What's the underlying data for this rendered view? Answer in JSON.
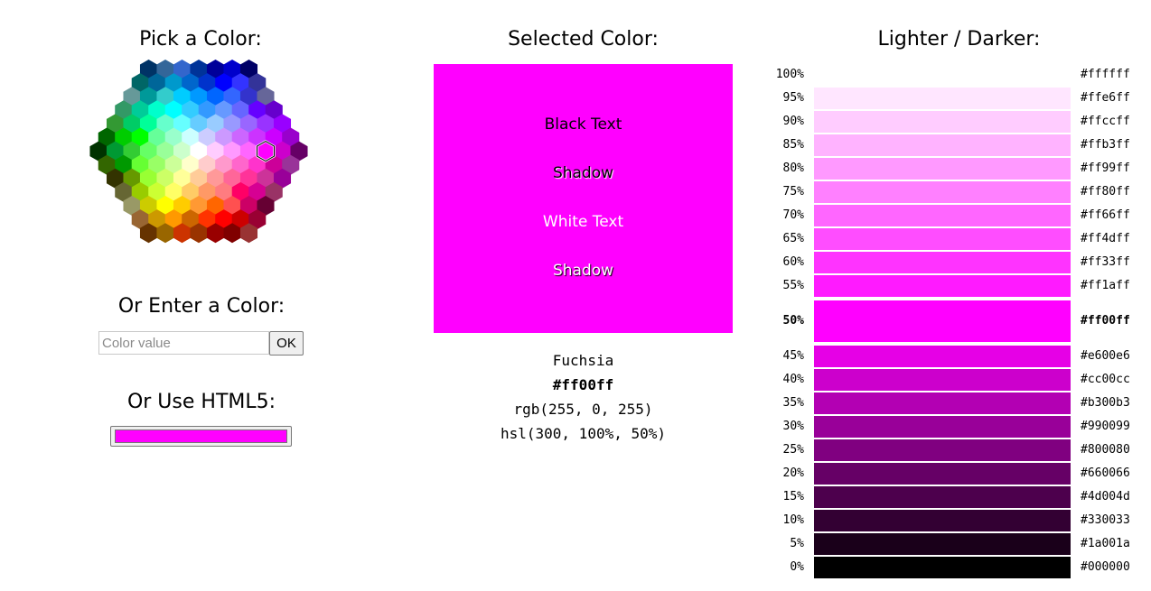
{
  "picker": {
    "title": "Pick a Color:",
    "selected_hex": "#ff00ff",
    "hex_rows": [
      [
        "#003366",
        "#336699",
        "#3366cc",
        "#003399",
        "#000099",
        "#0000cc",
        "#000066"
      ],
      [
        "#006666",
        "#006699",
        "#0099cc",
        "#0066cc",
        "#0033cc",
        "#0000ff",
        "#3333ff",
        "#333399"
      ],
      [
        "#669999",
        "#009999",
        "#33cccc",
        "#00ccff",
        "#0099ff",
        "#0066ff",
        "#3366ff",
        "#3333cc",
        "#666699"
      ],
      [
        "#339966",
        "#00cc99",
        "#00ffcc",
        "#00ffff",
        "#33ccff",
        "#3399ff",
        "#6699ff",
        "#6666ff",
        "#6600ff",
        "#6600cc"
      ],
      [
        "#339933",
        "#00cc66",
        "#00ff99",
        "#66ffcc",
        "#66ffff",
        "#66ccff",
        "#99ccff",
        "#9999ff",
        "#9966ff",
        "#9933ff",
        "#9900ff"
      ],
      [
        "#006600",
        "#00cc00",
        "#00ff00",
        "#66ff99",
        "#99ffcc",
        "#ccffff",
        "#ccccff",
        "#cc99ff",
        "#cc66ff",
        "#cc33ff",
        "#cc00ff",
        "#9900cc"
      ],
      [
        "#003300",
        "#009933",
        "#33cc33",
        "#66ff66",
        "#99ff99",
        "#ccffcc",
        "#ffffff",
        "#ffccff",
        "#ff99ff",
        "#ff66ff",
        "#ff00ff",
        "#cc00cc",
        "#660066"
      ],
      [
        "#336600",
        "#009900",
        "#66ff33",
        "#99ff66",
        "#ccff99",
        "#ffffcc",
        "#ffcccc",
        "#ff99cc",
        "#ff66cc",
        "#ff33cc",
        "#cc0099",
        "#993399"
      ],
      [
        "#333300",
        "#669900",
        "#99ff33",
        "#ccff66",
        "#ffff99",
        "#ffcc99",
        "#ff9999",
        "#ff6699",
        "#ff3399",
        "#cc3399",
        "#990099"
      ],
      [
        "#666633",
        "#99cc00",
        "#ccff33",
        "#ffff66",
        "#ffcc66",
        "#ff9966",
        "#ff7c80",
        "#ff0066",
        "#d60093",
        "#993366"
      ],
      [
        "#999966",
        "#cccc00",
        "#ffff00",
        "#ffcc00",
        "#ff9933",
        "#ff6600",
        "#ff5050",
        "#cc0066",
        "#660033"
      ],
      [
        "#996633",
        "#cc9900",
        "#ff9900",
        "#cc6600",
        "#ff3300",
        "#ff0000",
        "#cc0000",
        "#990033"
      ],
      [
        "#663300",
        "#996600",
        "#cc3300",
        "#993300",
        "#990000",
        "#800000",
        "#993333"
      ]
    ]
  },
  "enter": {
    "title": "Or Enter a Color:",
    "placeholder": "Color value",
    "ok_label": "OK"
  },
  "html5": {
    "title": "Or Use HTML5:",
    "value": "#ff00ff"
  },
  "selected": {
    "title": "Selected Color:",
    "color": "#ff00ff",
    "black_text": "Black Text",
    "black_shadow": "Shadow",
    "white_text": "White Text",
    "white_shadow": "Shadow",
    "name": "Fuchsia",
    "hex": "#ff00ff",
    "rgb": "rgb(255, 0, 255)",
    "hsl": "hsl(300, 100%, 50%)"
  },
  "shades": {
    "title": "Lighter / Darker:",
    "items": [
      {
        "pct": "100%",
        "hex": "#ffffff"
      },
      {
        "pct": "95%",
        "hex": "#ffe6ff"
      },
      {
        "pct": "90%",
        "hex": "#ffccff"
      },
      {
        "pct": "85%",
        "hex": "#ffb3ff"
      },
      {
        "pct": "80%",
        "hex": "#ff99ff"
      },
      {
        "pct": "75%",
        "hex": "#ff80ff"
      },
      {
        "pct": "70%",
        "hex": "#ff66ff"
      },
      {
        "pct": "65%",
        "hex": "#ff4dff"
      },
      {
        "pct": "60%",
        "hex": "#ff33ff"
      },
      {
        "pct": "55%",
        "hex": "#ff1aff"
      },
      {
        "pct": "50%",
        "hex": "#ff00ff",
        "selected": true
      },
      {
        "pct": "45%",
        "hex": "#e600e6"
      },
      {
        "pct": "40%",
        "hex": "#cc00cc"
      },
      {
        "pct": "35%",
        "hex": "#b300b3"
      },
      {
        "pct": "30%",
        "hex": "#990099"
      },
      {
        "pct": "25%",
        "hex": "#800080"
      },
      {
        "pct": "20%",
        "hex": "#660066"
      },
      {
        "pct": "15%",
        "hex": "#4d004d"
      },
      {
        "pct": "10%",
        "hex": "#330033"
      },
      {
        "pct": "5%",
        "hex": "#1a001a"
      },
      {
        "pct": "0%",
        "hex": "#000000"
      }
    ]
  }
}
